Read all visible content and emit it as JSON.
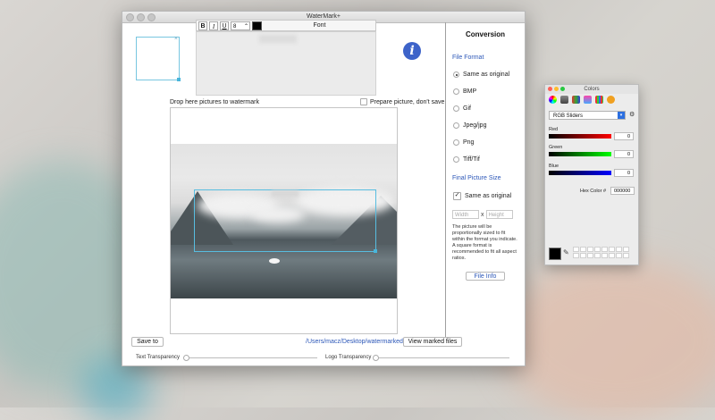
{
  "window": {
    "title": "WaterMark+"
  },
  "toolbar": {
    "bold": "B",
    "italic": "I",
    "underline": "U",
    "font_size": "8",
    "font_label": "Font"
  },
  "main": {
    "drop_label": "Drop here pictures to watermark",
    "prepare_label": "Prepare picture, don't save",
    "save_to_label": "Save to",
    "save_path": "/Users/macz/Desktop/watermarked",
    "view_marked_label": "View marked files",
    "text_transparency_label": "Text Transparency",
    "logo_transparency_label": "Logo Transparency"
  },
  "sidebar": {
    "title": "Conversion",
    "file_format_heading": "File Format",
    "formats": [
      {
        "label": "Same as original",
        "selected": true
      },
      {
        "label": "BMP",
        "selected": false
      },
      {
        "label": "Gif",
        "selected": false
      },
      {
        "label": "Jpeg/jpg",
        "selected": false
      },
      {
        "label": "Png",
        "selected": false
      },
      {
        "label": "Tiff/Tif",
        "selected": false
      }
    ],
    "final_size_heading": "Final Picture Size",
    "same_as_original_label": "Same as original",
    "width_placeholder": "Width",
    "times": "x",
    "height_placeholder": "Height",
    "note": "The picture will be proportionally sized to fit within the format you indicate. A square format is recommended to fit all aspect ratios.",
    "file_info_label": "File Info"
  },
  "colors_panel": {
    "title": "Colors",
    "mode": "RGB Sliders",
    "red_label": "Red",
    "red_value": "0",
    "green_label": "Green",
    "green_value": "0",
    "blue_label": "Blue",
    "blue_value": "0",
    "hex_label": "Hex Color #",
    "hex_value": "000000"
  },
  "colors": {
    "accent_blue": "#2c57b8",
    "selection_blue": "#58bde0",
    "info_icon": "#3d63c9"
  }
}
